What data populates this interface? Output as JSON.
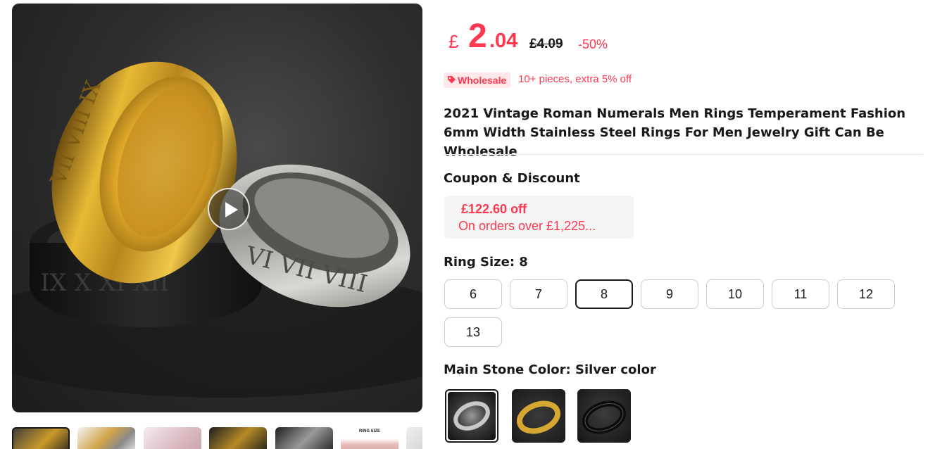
{
  "price": {
    "currency_symbol": "£",
    "integer_part": "2",
    "decimal_part": ".04",
    "original": "£4.09",
    "discount": "-50%"
  },
  "wholesale": {
    "badge_label": "Wholesale",
    "badge_icon": "tag-icon",
    "text": "10+ pieces, extra 5% off"
  },
  "product": {
    "title": "2021 Vintage Roman Numerals Men Rings Temperament Fashion 6mm Width Stainless Steel Rings For Men Jewelry Gift Can Be Wholesale"
  },
  "coupon": {
    "heading": "Coupon & Discount",
    "amount": "£122.60 off",
    "condition": "On orders over £1,225..."
  },
  "ring_size": {
    "heading": "Ring Size: 8",
    "options": [
      "6",
      "7",
      "8",
      "9",
      "10",
      "11",
      "12",
      "13"
    ],
    "selected": "8"
  },
  "stone_color": {
    "heading": "Main Stone Color: Silver color",
    "swatches": [
      "Silver color",
      "Gold color",
      "Black color"
    ],
    "selected": "Silver color"
  },
  "gallery": {
    "play_icon": "play-icon",
    "thumbnail_caption": "RING SIZE"
  },
  "colors": {
    "accent": "#fd384f",
    "wholesale_bg": "#ffe8ea",
    "coupon_bg": "#f5f5f5",
    "text": "#191919"
  }
}
